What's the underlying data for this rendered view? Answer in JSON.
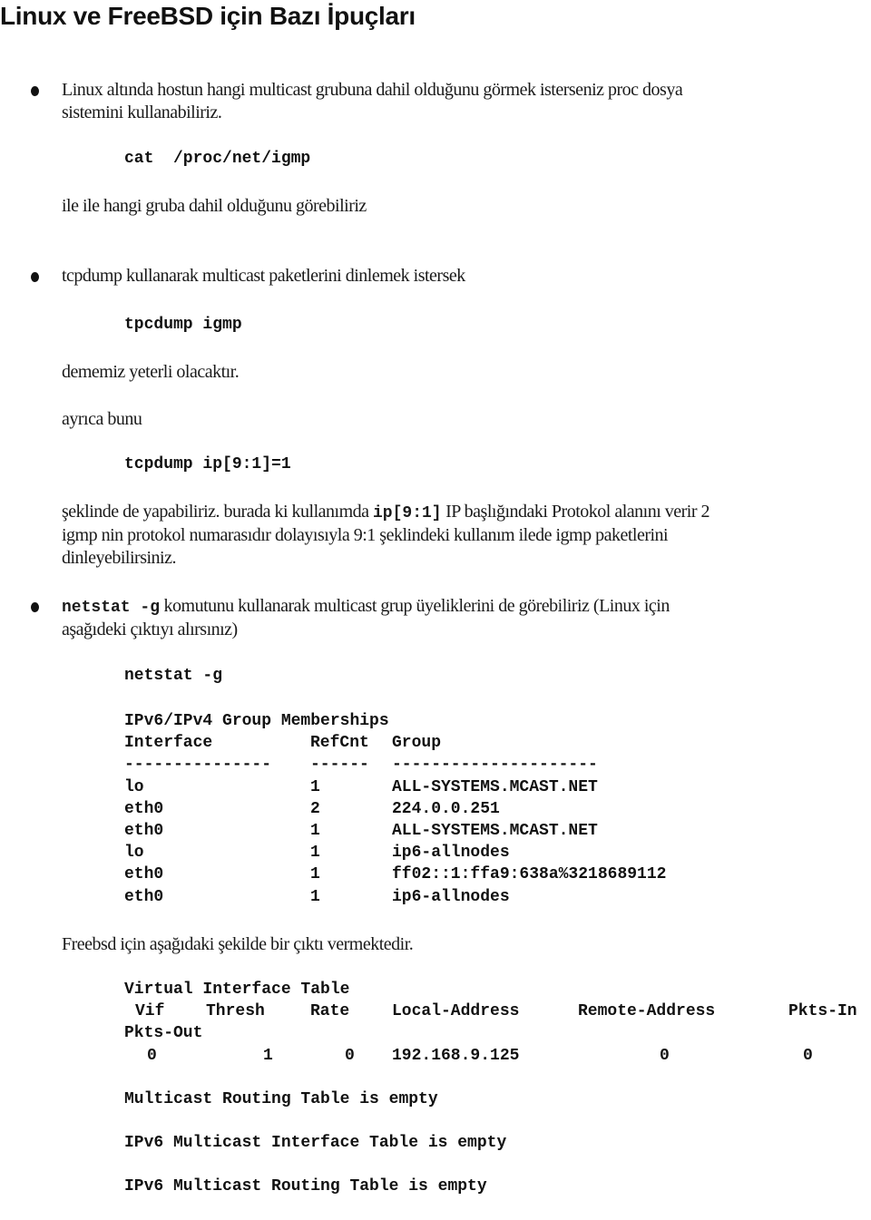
{
  "title": "Linux ve FreeBSD için Bazı İpuçları",
  "sections": {
    "proc": {
      "bullet_line1": "Linux altında hostun hangi multicast grubuna dahil olduğunu görmek isterseniz proc dosya",
      "bullet_line2": "sistemini kullanabiliriz.",
      "command": "cat  /proc/net/igmp",
      "after": "ile ile hangi gruba dahil olduğunu görebiliriz"
    },
    "tcpdump": {
      "bullet_text": "tcpdump kullanarak multicast paketlerini dinlemek istersek",
      "command": "tpcdump igmp",
      "after": "dememiz yeterli olacaktır.",
      "also": "ayrıca bunu",
      "command2": "tcpdump ip[9:1]=1",
      "explain_pre": "şeklinde de yapabiliriz. burada ki kullanımda ",
      "explain_code": "ip[9:1]",
      "explain_post": " IP başlığındaki Protokol alanını verir 2",
      "explain_line2": "igmp nin protokol numarasıdır dolayısıyla 9:1 şeklindeki kullanım ilede igmp paketlerini",
      "explain_line3": "dinleyebilirsiniz."
    },
    "netstat": {
      "bullet_code": "netstat -g",
      "bullet_text": " komutunu kullanarak multicast grup üyeliklerini de görebiliriz (Linux için",
      "bullet_line2": "aşağıdeki çıktıyı alırsınız)",
      "command": "netstat -g",
      "linux_output": {
        "heading": "IPv6/IPv4 Group Memberships",
        "columns": [
          "Interface",
          "RefCnt",
          "Group"
        ],
        "separators": [
          "---------------",
          "------",
          "---------------------"
        ],
        "rows": [
          [
            "lo",
            "1",
            "ALL-SYSTEMS.MCAST.NET"
          ],
          [
            "eth0",
            "2",
            "224.0.0.251"
          ],
          [
            "eth0",
            "1",
            "ALL-SYSTEMS.MCAST.NET"
          ],
          [
            "lo",
            "1",
            "ip6-allnodes"
          ],
          [
            "eth0",
            "1",
            "ff02::1:ffa9:638a%3218689112"
          ],
          [
            "eth0",
            "1",
            "ip6-allnodes"
          ]
        ]
      },
      "freebsd_intro": "Freebsd için aşağıdaki şekilde bir çıktı vermektedir.",
      "freebsd_output": {
        "heading": "Virtual Interface Table",
        "columns": [
          "Vif",
          "Thresh",
          "Rate",
          "Local-Address",
          "Remote-Address",
          "Pkts-In",
          "Pkts-Out"
        ],
        "row": [
          "0",
          "1",
          "0",
          "192.168.9.125",
          "0",
          "0"
        ],
        "lines": [
          "Multicast Routing Table is empty",
          "IPv6 Multicast Interface Table is empty",
          "IPv6 Multicast Routing Table is empty"
        ]
      }
    }
  }
}
